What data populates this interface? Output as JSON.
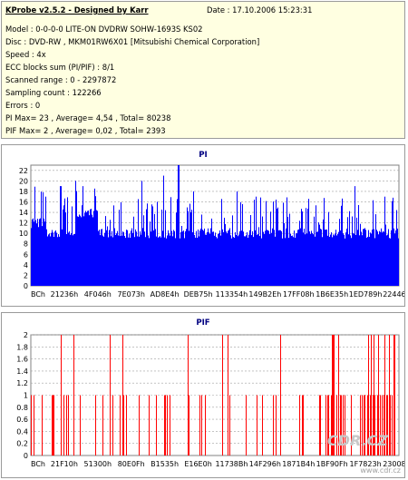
{
  "info": {
    "title": "KProbe v2.5.2 - Designed by Karr",
    "date": "Date : 17.10.2006 15:23:31",
    "lines": [
      "Model : 0-0-0-0 LITE-ON DVDRW SOHW-1693S KS02",
      "Disc : DVD-RW , MKM01RW6X01 [Mitsubishi Chemical Corporation]",
      "Speed : 4x",
      "ECC blocks sum (PI/PIF) : 8/1",
      "Scanned range : 0 - 2297872",
      "Sampling count : 122266",
      "Errors : 0",
      "PI Max= 23 , Average= 4,54 , Total= 80238",
      "PIF Max= 2 , Average= 0,02 , Total= 2393"
    ]
  },
  "chart_data": [
    {
      "type": "bar",
      "title": "PI",
      "color": "#0000ff",
      "ylim": [
        0,
        23
      ],
      "yticks": [
        "0",
        "2",
        "4",
        "6",
        "8",
        "10",
        "12",
        "14",
        "16",
        "18",
        "20",
        "22"
      ],
      "categories": [
        "BCh",
        "21236h",
        "4F046h",
        "7E073h",
        "AD8E4h",
        "DEB75h",
        "113354h",
        "149B2Eh",
        "17FF08h",
        "1B6E35h",
        "1ED789h",
        "224464h"
      ],
      "max": 23,
      "average": 4.54,
      "baseline_profile": [
        {
          "from": 0.0,
          "to": 0.04,
          "level": 12
        },
        {
          "from": 0.04,
          "to": 0.12,
          "level": 10
        },
        {
          "from": 0.12,
          "to": 0.18,
          "level": 14
        },
        {
          "from": 0.18,
          "to": 1.0,
          "level": 10
        }
      ],
      "peaks": [
        {
          "pos": 0.04,
          "value": 17
        },
        {
          "pos": 0.08,
          "value": 19
        },
        {
          "pos": 0.12,
          "value": 20
        },
        {
          "pos": 0.14,
          "value": 19
        },
        {
          "pos": 0.3,
          "value": 20
        },
        {
          "pos": 0.36,
          "value": 21
        },
        {
          "pos": 0.4,
          "value": 23
        },
        {
          "pos": 0.44,
          "value": 18
        },
        {
          "pos": 0.56,
          "value": 18
        },
        {
          "pos": 0.61,
          "value": 17
        },
        {
          "pos": 0.88,
          "value": 19
        },
        {
          "pos": 0.96,
          "value": 17
        }
      ]
    },
    {
      "type": "bar",
      "title": "PIF",
      "color": "#ff0000",
      "ylim": [
        0,
        2
      ],
      "yticks": [
        "0",
        "0.2",
        "0.4",
        "0.6",
        "0.8",
        "1",
        "1.2",
        "1.4",
        "1.6",
        "1.8",
        "2"
      ],
      "categories": [
        "BCh",
        "21F10h",
        "51300h",
        "80E0Fh",
        "B1535h",
        "E16E0h",
        "11738Bh",
        "14F296h",
        "1871B4h",
        "1BF90Fh",
        "1F7823h",
        "230081h"
      ],
      "max": 2,
      "average": 0.02
    }
  ],
  "watermark": "CDR.CZ",
  "watermark_url": "www.cdr.cz"
}
